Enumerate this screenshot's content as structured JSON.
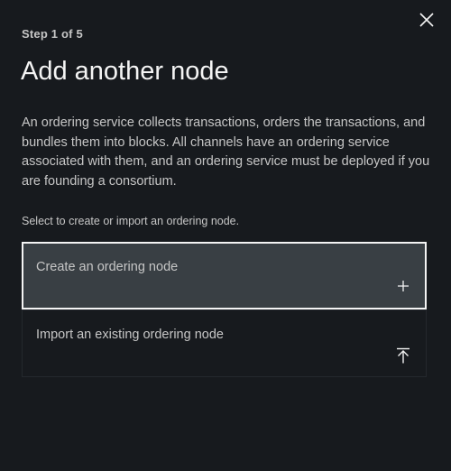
{
  "modal": {
    "step_label": "Step 1 of 5",
    "title": "Add another node",
    "description": "An ordering service collects transactions, orders the transactions, and bundles them into blocks. All channels have an ordering service associated with them, and an ordering service must be deployed if you are founding a consortium.",
    "instruction": "Select to create or import an ordering node.",
    "close_icon": "close-icon"
  },
  "options": [
    {
      "label": "Create an ordering node",
      "icon": "plus-icon",
      "selected": true
    },
    {
      "label": "Import an existing ordering node",
      "icon": "upload-icon",
      "selected": false
    }
  ],
  "colors": {
    "background": "#171a1e",
    "tile_selected": "#393f44",
    "text_primary": "#f4f4f4",
    "text_secondary": "#c6c6c6"
  }
}
